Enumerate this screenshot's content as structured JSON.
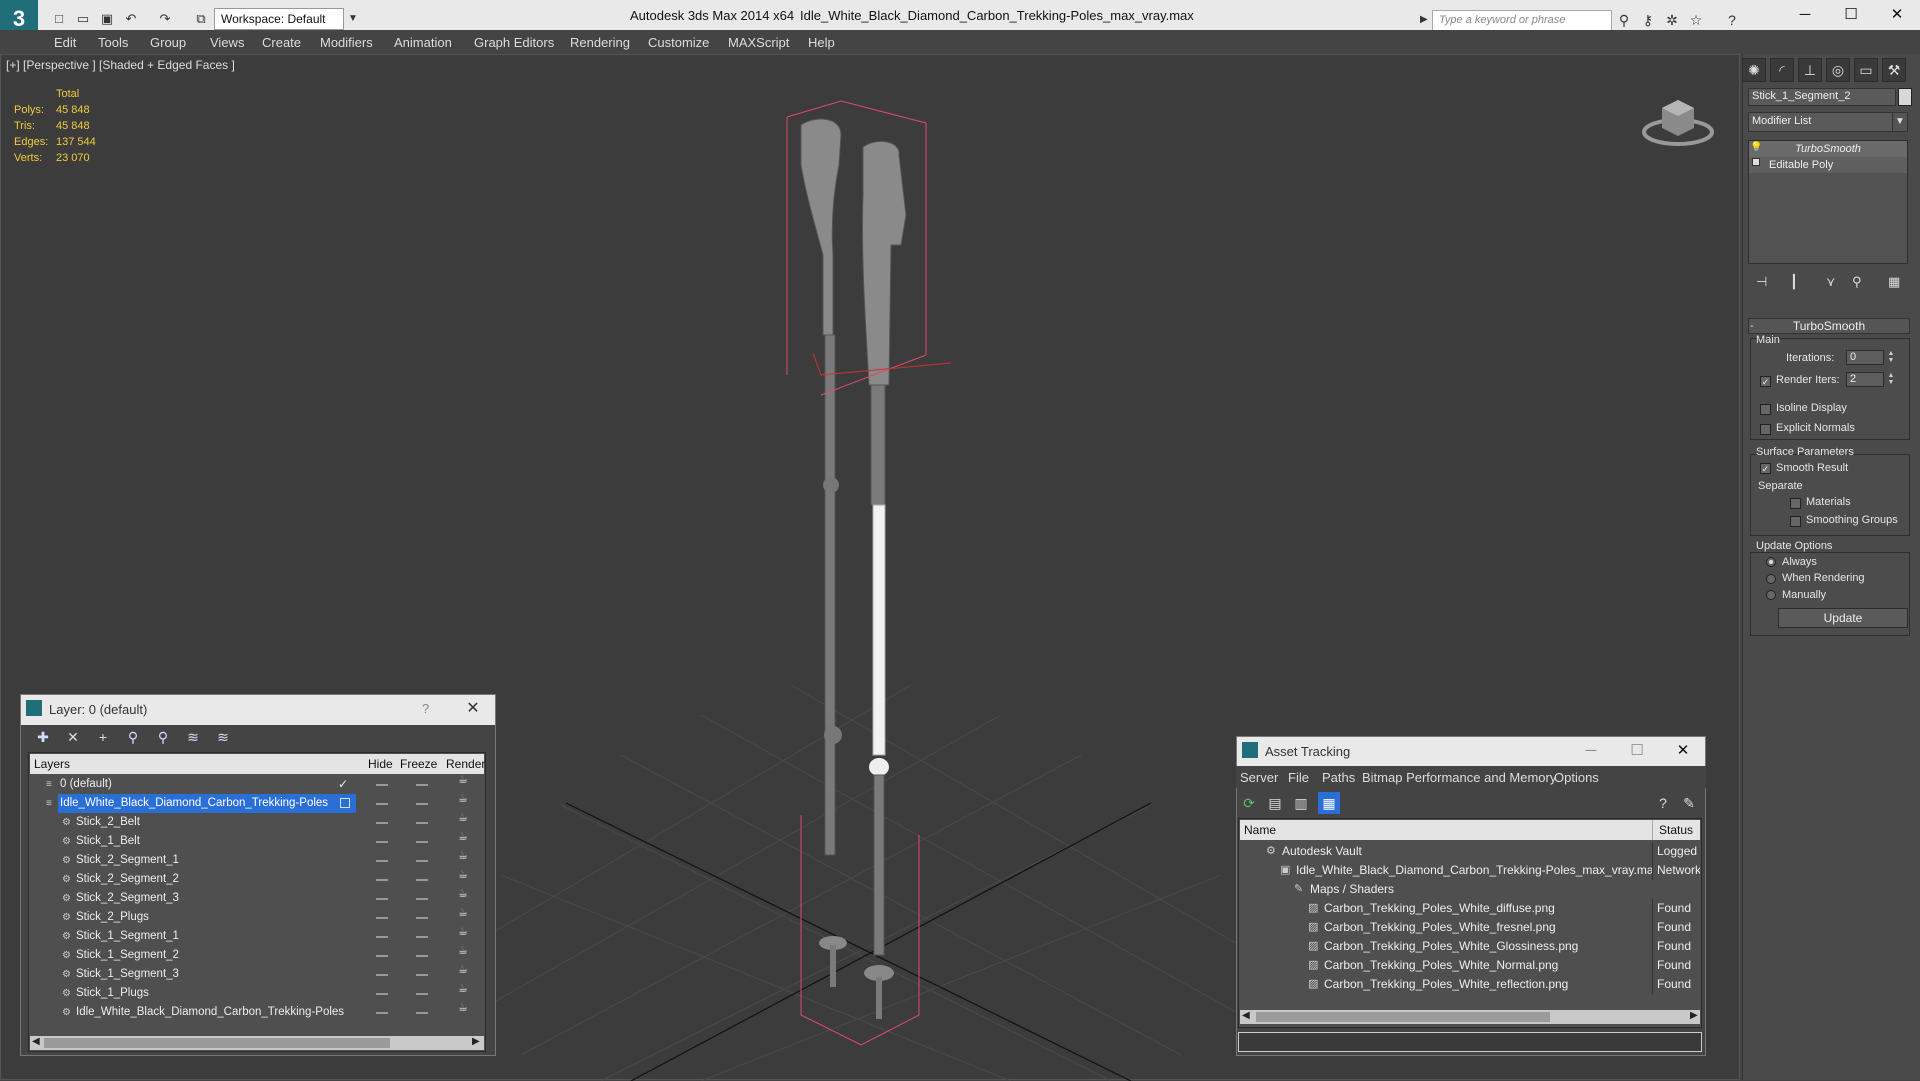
{
  "app": {
    "logo": "3",
    "title": "Autodesk 3ds Max  2014 x64",
    "file": "Idle_White_Black_Diamond_Carbon_Trekking-Poles_max_vray.max",
    "workspace": "Workspace: Default",
    "search_placeholder": "Type a keyword or phrase"
  },
  "menu": [
    "Edit",
    "Tools",
    "Group",
    "Views",
    "Create",
    "Modifiers",
    "Animation",
    "Graph Editors",
    "Rendering",
    "Customize",
    "MAXScript",
    "Help"
  ],
  "viewport": {
    "label": "[+] [Perspective ] [Shaded + Edged Faces ]",
    "stats": {
      "header": "Total",
      "rows": [
        {
          "label": "Polys:",
          "value": "45 848"
        },
        {
          "label": "Tris:",
          "value": "45 848"
        },
        {
          "label": "Edges:",
          "value": "137 544"
        },
        {
          "label": "Verts:",
          "value": "23 070"
        }
      ]
    }
  },
  "command_panel": {
    "object_name": "Stick_1_Segment_2",
    "modifier_list": "Modifier List",
    "stack": [
      "TurboSmooth",
      "Editable Poly"
    ],
    "rollout": "TurboSmooth",
    "main_label": "Main",
    "iterations_label": "Iterations:",
    "iterations": "0",
    "render_iters_label": "Render Iters:",
    "render_iters": "2",
    "isoline": "Isoline Display",
    "explicit_normals": "Explicit Normals",
    "surface_params": "Surface Parameters",
    "smooth_result": "Smooth Result",
    "separate": "Separate",
    "materials": "Materials",
    "smoothing_groups": "Smoothing Groups",
    "update_options": "Update Options",
    "always": "Always",
    "when_rendering": "When Rendering",
    "manually": "Manually",
    "update_btn": "Update"
  },
  "layer_window": {
    "title": "Layer: 0 (default)",
    "help": "?",
    "columns": {
      "layers": "Layers",
      "hide": "Hide",
      "freeze": "Freeze",
      "render": "Render"
    },
    "rows": [
      {
        "name": "0 (default)",
        "indent": 1
      },
      {
        "name": "Idle_White_Black_Diamond_Carbon_Trekking-Poles",
        "indent": 1
      },
      {
        "name": "Stick_2_Belt",
        "indent": 2
      },
      {
        "name": "Stick_1_Belt",
        "indent": 2
      },
      {
        "name": "Stick_2_Segment_1",
        "indent": 2
      },
      {
        "name": "Stick_2_Segment_2",
        "indent": 2
      },
      {
        "name": "Stick_2_Segment_3",
        "indent": 2
      },
      {
        "name": "Stick_2_Plugs",
        "indent": 2
      },
      {
        "name": "Stick_1_Segment_1",
        "indent": 2
      },
      {
        "name": "Stick_1_Segment_2",
        "indent": 2
      },
      {
        "name": "Stick_1_Segment_3",
        "indent": 2
      },
      {
        "name": "Stick_1_Plugs",
        "indent": 2
      },
      {
        "name": "Idle_White_Black_Diamond_Carbon_Trekking-Poles",
        "indent": 2
      }
    ]
  },
  "asset_window": {
    "title": "Asset Tracking",
    "menu": [
      "Server",
      "File",
      "Paths",
      "Bitmap Performance and Memory",
      "Options"
    ],
    "columns": {
      "name": "Name",
      "status": "Status"
    },
    "rows": [
      {
        "name": "Autodesk Vault",
        "status": "Logged",
        "indent": 1
      },
      {
        "name": "Idle_White_Black_Diamond_Carbon_Trekking-Poles_max_vray.max",
        "status": "Network",
        "indent": 2
      },
      {
        "name": "Maps / Shaders",
        "status": "",
        "indent": 3
      },
      {
        "name": "Carbon_Trekking_Poles_White_diffuse.png",
        "status": "Found",
        "indent": 4
      },
      {
        "name": "Carbon_Trekking_Poles_White_fresnel.png",
        "status": "Found",
        "indent": 4
      },
      {
        "name": "Carbon_Trekking_Poles_White_Glossiness.png",
        "status": "Found",
        "indent": 4
      },
      {
        "name": "Carbon_Trekking_Poles_White_Normal.png",
        "status": "Found",
        "indent": 4
      },
      {
        "name": "Carbon_Trekking_Poles_White_reflection.png",
        "status": "Found",
        "indent": 4
      }
    ]
  }
}
